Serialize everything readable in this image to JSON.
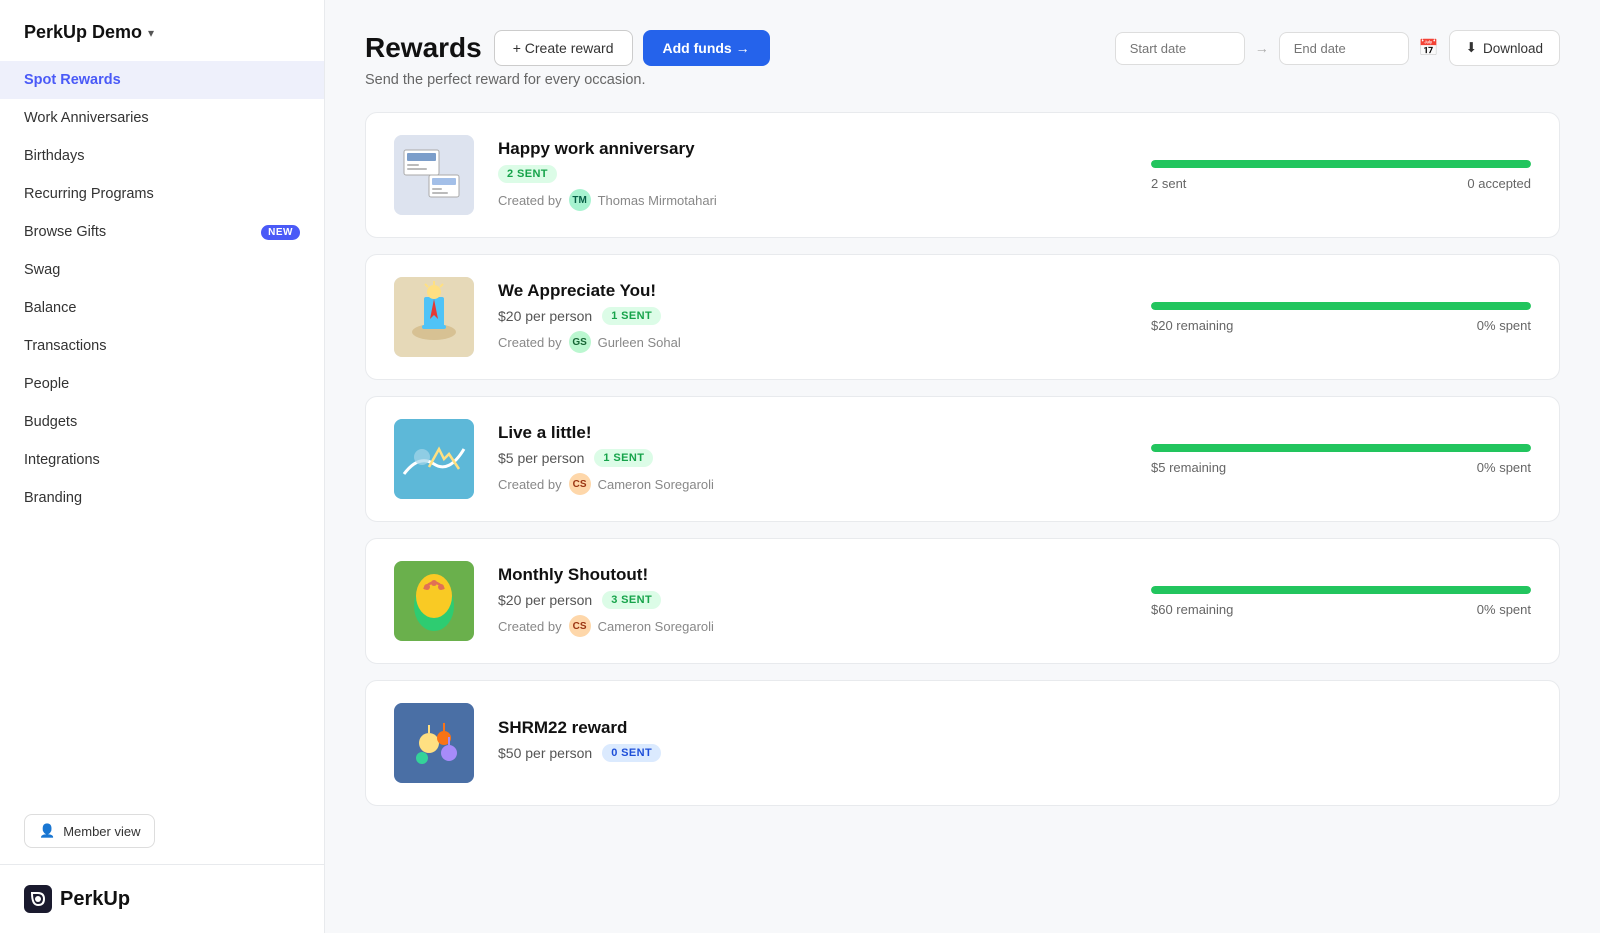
{
  "app": {
    "title": "PerkUp Demo",
    "chevron": "▾"
  },
  "sidebar": {
    "items": [
      {
        "id": "spot-rewards",
        "label": "Spot Rewards",
        "active": true,
        "badge": null
      },
      {
        "id": "work-anniversaries",
        "label": "Work Anniversaries",
        "active": false,
        "badge": null
      },
      {
        "id": "birthdays",
        "label": "Birthdays",
        "active": false,
        "badge": null
      },
      {
        "id": "recurring-programs",
        "label": "Recurring Programs",
        "active": false,
        "badge": null
      },
      {
        "id": "browse-gifts",
        "label": "Browse Gifts",
        "active": false,
        "badge": "NEW"
      },
      {
        "id": "swag",
        "label": "Swag",
        "active": false,
        "badge": null
      },
      {
        "id": "balance",
        "label": "Balance",
        "active": false,
        "badge": null
      },
      {
        "id": "transactions",
        "label": "Transactions",
        "active": false,
        "badge": null
      },
      {
        "id": "people",
        "label": "People",
        "active": false,
        "badge": null
      },
      {
        "id": "budgets",
        "label": "Budgets",
        "active": false,
        "badge": null
      },
      {
        "id": "integrations",
        "label": "Integrations",
        "active": false,
        "badge": null
      },
      {
        "id": "branding",
        "label": "Branding",
        "active": false,
        "badge": null
      }
    ],
    "member_view_label": "Member view",
    "logo_text": "PerkUp"
  },
  "header": {
    "title": "Rewards",
    "subtitle": "Send the perfect reward for every occasion.",
    "create_reward_label": "+ Create reward",
    "add_funds_label": "Add funds →",
    "start_date_placeholder": "Start date",
    "end_date_placeholder": "End date",
    "download_label": "Download"
  },
  "rewards": [
    {
      "id": "happy-work-anniversary",
      "title": "Happy work anniversary",
      "amount": null,
      "badge_text": "2 SENT",
      "badge_type": "green",
      "created_by": "Thomas Mirmotahari",
      "creator_initials": "TM",
      "creator_color": "#a7f3d0",
      "creator_text_color": "#065f46",
      "stat_left": "2 sent",
      "stat_right": "0 accepted",
      "progress": 100,
      "image_emoji": "🖥️",
      "image_bg": "#e8edf5"
    },
    {
      "id": "we-appreciate-you",
      "title": "We Appreciate You!",
      "amount": "$20 per person",
      "badge_text": "1 SENT",
      "badge_type": "green",
      "created_by": "Gurleen Sohal",
      "creator_initials": "GS",
      "creator_color": "#bbf7d0",
      "creator_text_color": "#166534",
      "stat_left": "$20 remaining",
      "stat_right": "0% spent",
      "progress": 100,
      "image_emoji": "🚀",
      "image_bg": "#dbeafe"
    },
    {
      "id": "live-a-little",
      "title": "Live a little!",
      "amount": "$5 per person",
      "badge_text": "1 SENT",
      "badge_type": "green",
      "created_by": "Cameron Soregaroli",
      "creator_initials": "CS",
      "creator_color": "#fed7aa",
      "creator_text_color": "#9a3412",
      "stat_left": "$5 remaining",
      "stat_right": "0% spent",
      "progress": 100,
      "image_emoji": "🏄",
      "image_bg": "#bae6fd"
    },
    {
      "id": "monthly-shoutout",
      "title": "Monthly Shoutout!",
      "amount": "$20 per person",
      "badge_text": "3 SENT",
      "badge_type": "green",
      "created_by": "Cameron Soregaroli",
      "creator_initials": "CS",
      "creator_color": "#fed7aa",
      "creator_text_color": "#9a3412",
      "stat_left": "$60 remaining",
      "stat_right": "0% spent",
      "progress": 100,
      "image_emoji": "🌸",
      "image_bg": "#fce7f3"
    },
    {
      "id": "shrm22-reward",
      "title": "SHRM22 reward",
      "amount": "$50 per person",
      "badge_text": "0 SENT",
      "badge_type": "blue",
      "created_by": "",
      "creator_initials": "",
      "creator_color": "#e0e7ff",
      "creator_text_color": "#3730a3",
      "stat_left": "",
      "stat_right": "",
      "progress": 0,
      "image_emoji": "🎈",
      "image_bg": "#c7d2fe"
    }
  ]
}
